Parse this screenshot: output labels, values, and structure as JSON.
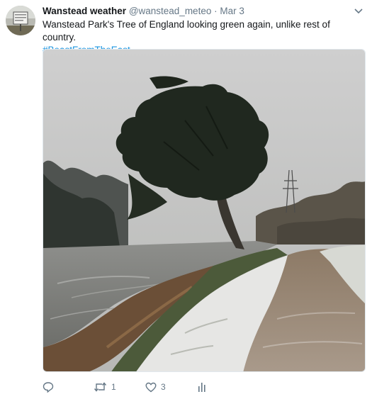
{
  "tweet": {
    "display_name": "Wanstead weather",
    "handle": "@wanstead_meteo",
    "separator": "·",
    "date": "Mar 3",
    "text": "Wanstead Park's Tree of England looking green again, unlike rest of country.",
    "hashtag": "#BeastFromTheEast"
  },
  "actions": {
    "reply_icon": "reply-icon",
    "retweet_icon": "retweet-icon",
    "retweet_count": "1",
    "like_icon": "heart-icon",
    "like_count": "3",
    "analytics_icon": "analytics-icon"
  },
  "colors": {
    "link": "#1b95e0",
    "secondary_text": "#657786",
    "primary_text": "#14171a"
  }
}
